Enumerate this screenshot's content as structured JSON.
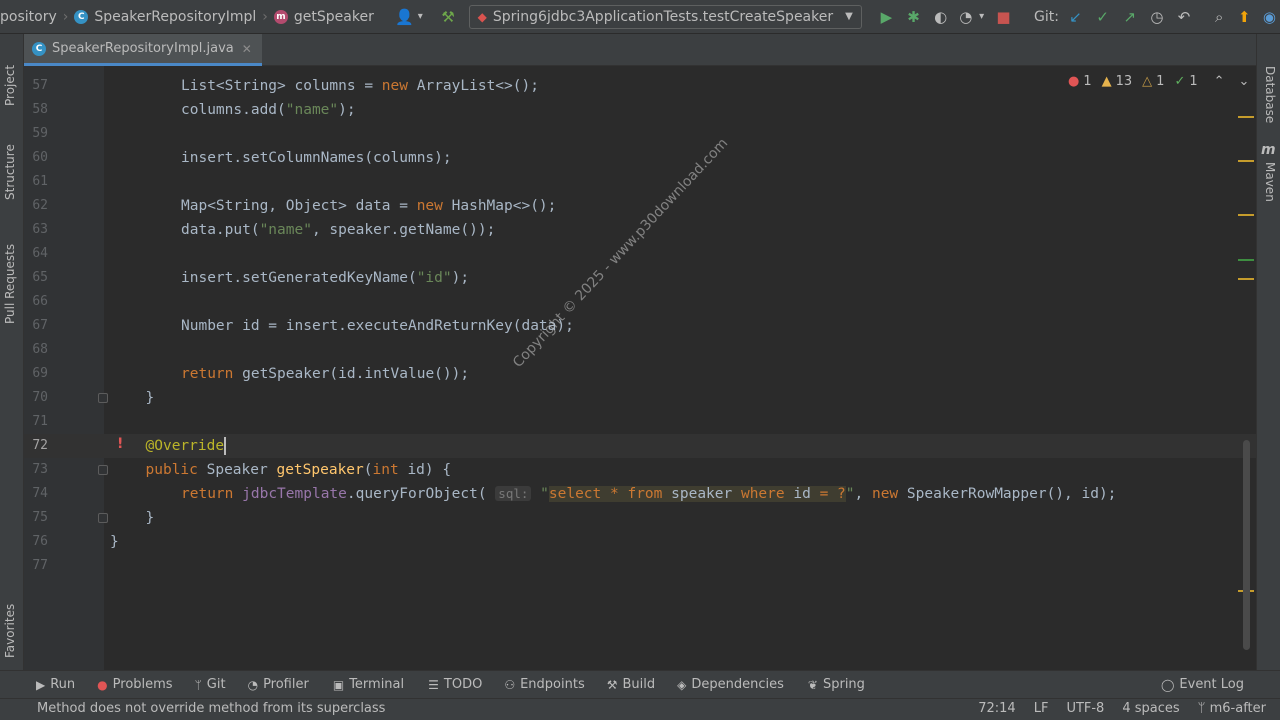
{
  "breadcrumbs": [
    {
      "label": "pository",
      "icon": ""
    },
    {
      "label": "SpeakerRepositoryImpl",
      "icon": "class-icon"
    },
    {
      "label": "getSpeaker",
      "icon": "method-icon"
    }
  ],
  "run_config": {
    "label": "Spring6jdbc3ApplicationTests.testCreateSpeaker"
  },
  "vcs": {
    "label": "Git:"
  },
  "icons": {
    "class_letter": "C",
    "method_letter": "m",
    "maven_letter": "m"
  },
  "editor_tab": {
    "label": "SpeakerRepositoryImpl.java"
  },
  "left_tools": {
    "project": "Project",
    "structure": "Structure",
    "pull_requests": "Pull Requests",
    "favorites": "Favorites"
  },
  "right_tools": {
    "database": "Database",
    "maven": "Maven"
  },
  "inspections": {
    "errors": "1",
    "warnings": "13",
    "weak_warnings": "1",
    "ok": "1"
  },
  "lines": [
    {
      "num": "57",
      "code": "List<String> columns = new ArrayList<>();"
    },
    {
      "num": "58",
      "code": "columns.add(\"name\");"
    },
    {
      "num": "59",
      "code": ""
    },
    {
      "num": "60",
      "code": "insert.setColumnNames(columns);"
    },
    {
      "num": "61",
      "code": ""
    },
    {
      "num": "62",
      "code": "Map<String, Object> data = new HashMap<>();"
    },
    {
      "num": "63",
      "code": "data.put(\"name\", speaker.getName());"
    },
    {
      "num": "64",
      "code": ""
    },
    {
      "num": "65",
      "code": "insert.setGeneratedKeyName(\"id\");"
    },
    {
      "num": "66",
      "code": ""
    },
    {
      "num": "67",
      "code": "Number id = insert.executeAndReturnKey(data);"
    },
    {
      "num": "68",
      "code": ""
    },
    {
      "num": "69",
      "code": "return getSpeaker(id.intValue());"
    },
    {
      "num": "70",
      "code": "}"
    },
    {
      "num": "71",
      "code": ""
    },
    {
      "num": "72",
      "code": "@Override"
    },
    {
      "num": "73",
      "code": "public Speaker getSpeaker(int id) {"
    },
    {
      "num": "74",
      "code": "return jdbcTemplate.queryForObject( sql: \"select * from speaker where id = ?\", new SpeakerRowMapper(), id);"
    },
    {
      "num": "75",
      "code": "}"
    },
    {
      "num": "76",
      "code": "}"
    },
    {
      "num": "77",
      "code": ""
    }
  ],
  "watermark": "Copyright © 2025 - www.p30download.com",
  "bottom_tools": [
    "Run",
    "Problems",
    "Git",
    "Profiler",
    "Terminal",
    "TODO",
    "Endpoints",
    "Build",
    "Dependencies",
    "Spring"
  ],
  "event_log": "Event Log",
  "status": {
    "message": "Method does not override method from its superclass",
    "position": "72:14",
    "line_sep": "LF",
    "encoding": "UTF-8",
    "indent": "4 spaces",
    "branch": "m6-after"
  },
  "colors": {
    "keyword": "#cc7832",
    "string": "#6a8759",
    "function": "#ffc66d",
    "annotation": "#bbb529",
    "accent": "#4a88c7"
  }
}
